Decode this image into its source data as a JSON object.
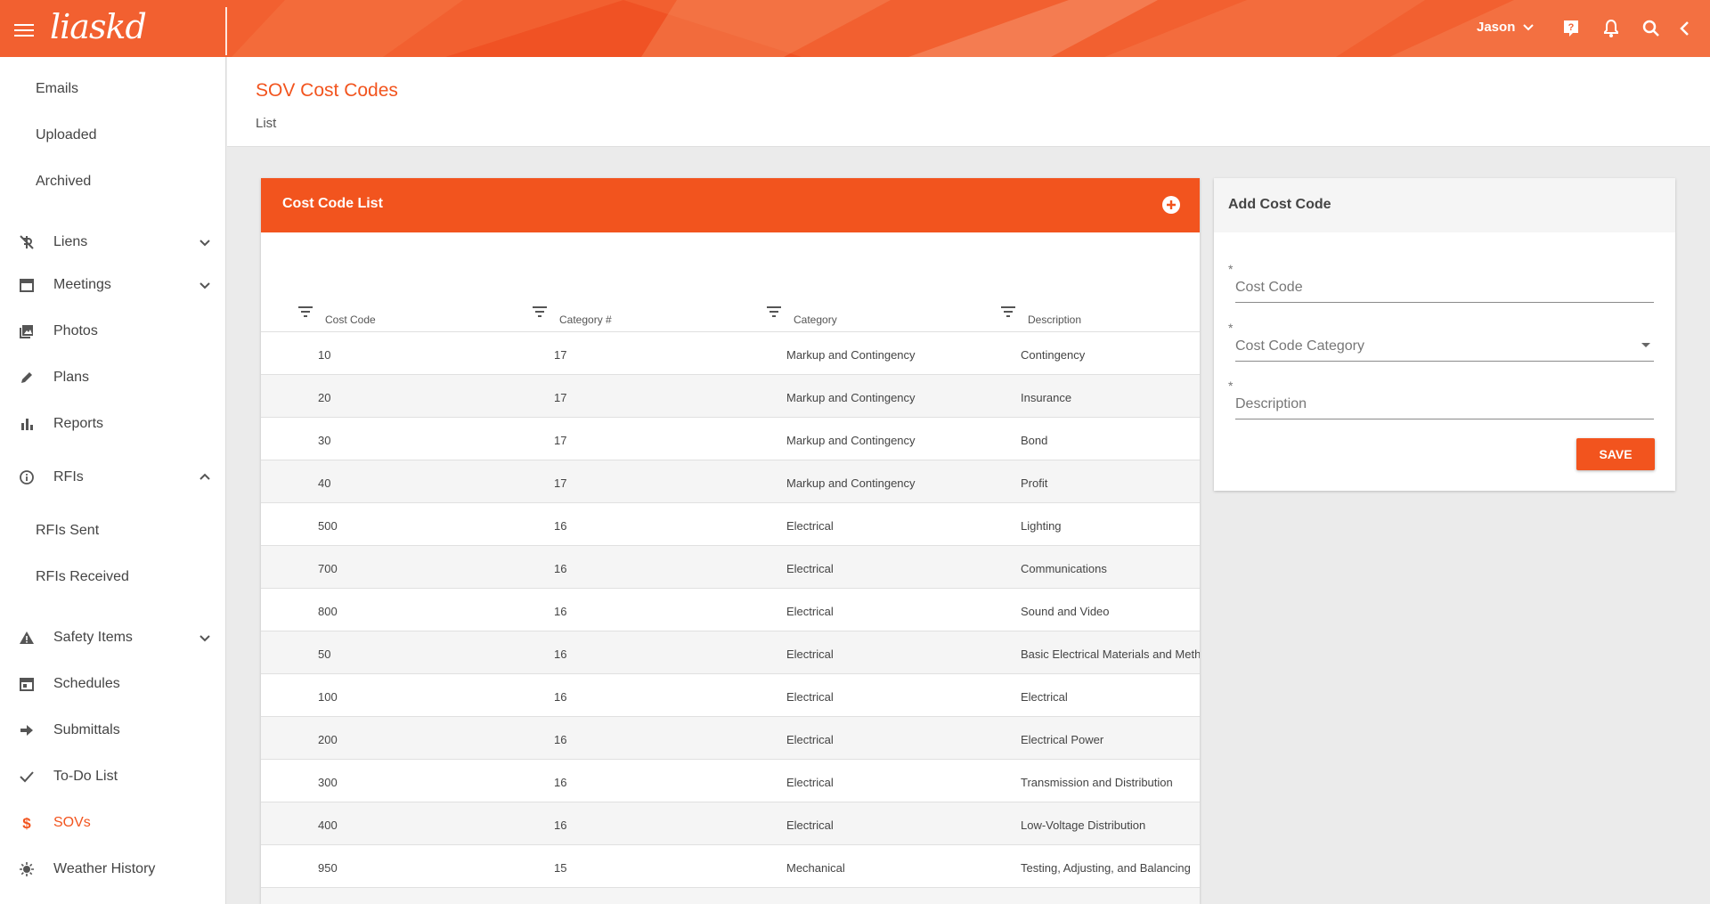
{
  "header": {
    "logo": "liaskd",
    "user_name": "Jason",
    "icons": [
      "menu-icon",
      "help-icon",
      "bell-icon",
      "search-icon",
      "collapse-icon"
    ]
  },
  "sidebar": {
    "items": [
      {
        "label": "Emails",
        "icon": "",
        "expandable": ""
      },
      {
        "label": "Uploaded",
        "icon": "",
        "expandable": ""
      },
      {
        "label": "Archived",
        "icon": "",
        "expandable": ""
      },
      {
        "label": "Liens",
        "icon": "lien-icon",
        "expandable": "down"
      },
      {
        "label": "Meetings",
        "icon": "calendar-icon",
        "expandable": "down"
      },
      {
        "label": "Photos",
        "icon": "photos-icon",
        "expandable": ""
      },
      {
        "label": "Plans",
        "icon": "pencil-icon",
        "expandable": ""
      },
      {
        "label": "Reports",
        "icon": "bar-chart-icon",
        "expandable": ""
      },
      {
        "label": "RFIs",
        "icon": "info-icon",
        "expandable": "up"
      },
      {
        "label": "RFIs Sent",
        "icon": "",
        "expandable": ""
      },
      {
        "label": "RFIs Received",
        "icon": "",
        "expandable": ""
      },
      {
        "label": "Safety Items",
        "icon": "warning-icon",
        "expandable": "down"
      },
      {
        "label": "Schedules",
        "icon": "schedule-icon",
        "expandable": ""
      },
      {
        "label": "Submittals",
        "icon": "arrow-right-icon",
        "expandable": ""
      },
      {
        "label": "To-Do List",
        "icon": "check-icon",
        "expandable": ""
      },
      {
        "label": "SOVs",
        "icon": "dollar-icon",
        "expandable": ""
      },
      {
        "label": "Weather History",
        "icon": "sun-icon",
        "expandable": ""
      }
    ],
    "active": "SOVs"
  },
  "page": {
    "title": "SOV Cost Codes",
    "subtitle": "List"
  },
  "cost_code_list": {
    "title": "Cost Code List",
    "add_icon": "add-circle-icon",
    "columns": [
      "Cost Code",
      "Category #",
      "Category",
      "Description"
    ],
    "rows": [
      [
        "10",
        "17",
        "Markup and Contingency",
        "Contingency"
      ],
      [
        "20",
        "17",
        "Markup and Contingency",
        "Insurance"
      ],
      [
        "30",
        "17",
        "Markup and Contingency",
        "Bond"
      ],
      [
        "40",
        "17",
        "Markup and Contingency",
        "Profit"
      ],
      [
        "500",
        "16",
        "Electrical",
        "Lighting"
      ],
      [
        "700",
        "16",
        "Electrical",
        "Communications"
      ],
      [
        "800",
        "16",
        "Electrical",
        "Sound and Video"
      ],
      [
        "50",
        "16",
        "Electrical",
        "Basic Electrical Materials and Meth"
      ],
      [
        "100",
        "16",
        "Electrical",
        "Electrical"
      ],
      [
        "200",
        "16",
        "Electrical",
        "Electrical Power"
      ],
      [
        "300",
        "16",
        "Electrical",
        "Transmission and Distribution"
      ],
      [
        "400",
        "16",
        "Electrical",
        "Low-Voltage Distribution"
      ],
      [
        "950",
        "15",
        "Mechanical",
        "Testing, Adjusting, and Balancing"
      ]
    ]
  },
  "add_cost_code": {
    "title": "Add Cost Code",
    "fields": [
      {
        "placeholder": "Cost Code",
        "required": "*",
        "type": "text"
      },
      {
        "placeholder": "Cost Code Category",
        "required": "*",
        "type": "select"
      },
      {
        "placeholder": "Description",
        "required": "*",
        "type": "text"
      }
    ],
    "save_label": "SAVE"
  },
  "colors": {
    "brand": "#f2541e",
    "header_bg": "#f26030"
  }
}
